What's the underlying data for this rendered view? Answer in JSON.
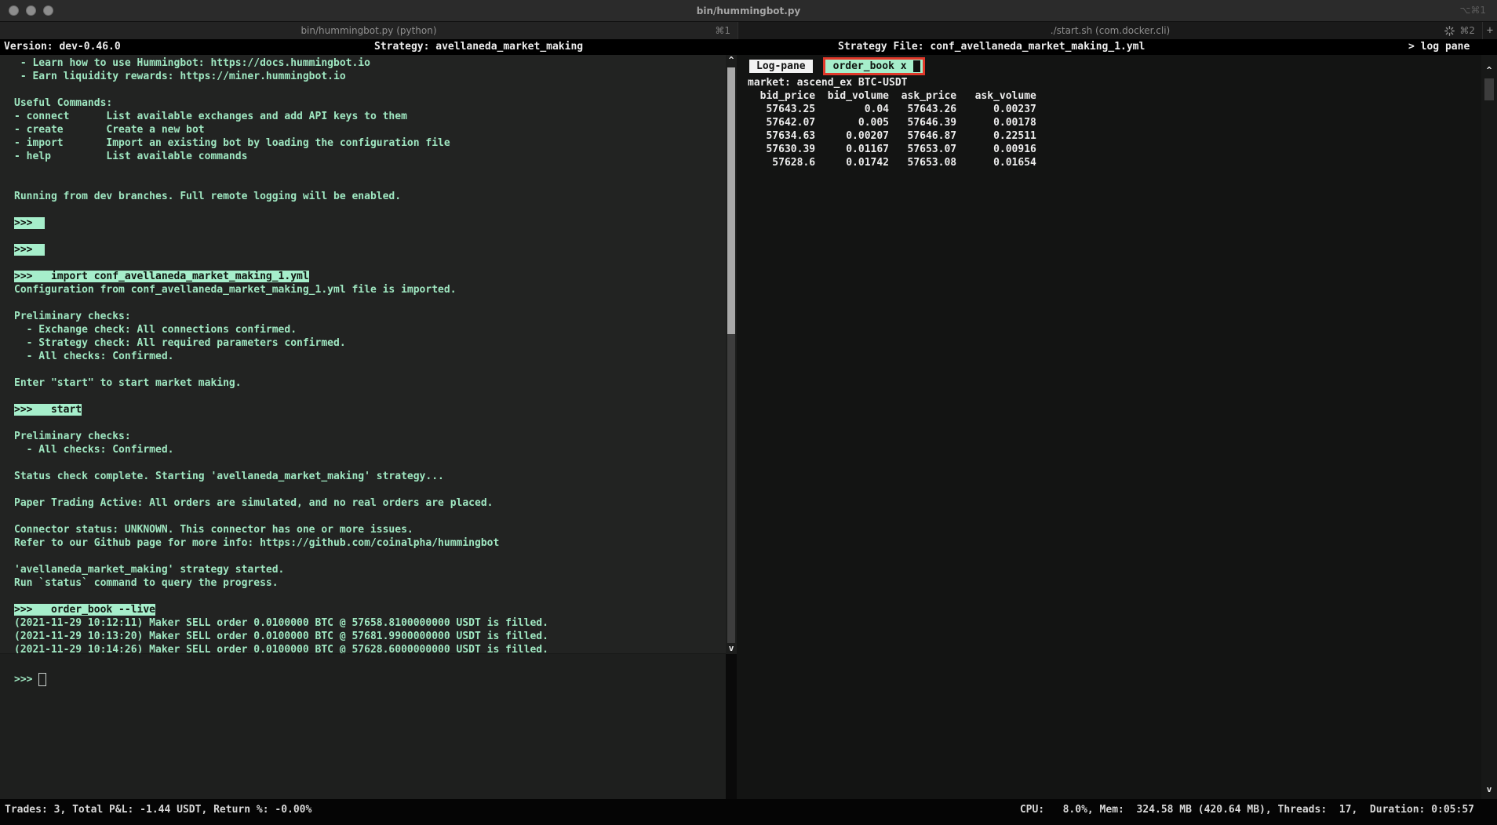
{
  "window": {
    "title": "bin/hummingbot.py",
    "titlebar_shortcut": "⌥⌘1",
    "tabs": [
      {
        "label": "bin/hummingbot.py (python)",
        "shortcut": "⌘1"
      },
      {
        "label": "./start.sh (com.docker.cli)",
        "shortcut": "⌘2"
      }
    ],
    "new_tab_button": "+"
  },
  "header": {
    "version": "Version: dev-0.46.0",
    "strategy": "Strategy: avellaneda_market_making",
    "strategy_file": "Strategy File: conf_avellaneda_market_making_1.yml",
    "log_pane_link": "> log pane"
  },
  "left_pane": {
    "lines": [
      {
        "text": " - Learn how to use Hummingbot: https://docs.hummingbot.io",
        "highlighted": false
      },
      {
        "text": " - Earn liquidity rewards: https://miner.hummingbot.io",
        "highlighted": false
      },
      {
        "text": "",
        "highlighted": false
      },
      {
        "text": "Useful Commands:",
        "highlighted": false
      },
      {
        "text": "- connect      List available exchanges and add API keys to them",
        "highlighted": false
      },
      {
        "text": "- create       Create a new bot",
        "highlighted": false
      },
      {
        "text": "- import       Import an existing bot by loading the configuration file",
        "highlighted": false
      },
      {
        "text": "- help         List available commands",
        "highlighted": false
      },
      {
        "text": "",
        "highlighted": false
      },
      {
        "text": "",
        "highlighted": false
      },
      {
        "text": "Running from dev branches. Full remote logging will be enabled.",
        "highlighted": false
      },
      {
        "text": "",
        "highlighted": false
      },
      {
        "text": ">>>  ",
        "highlighted": true
      },
      {
        "text": "",
        "highlighted": false
      },
      {
        "text": ">>>  ",
        "highlighted": true
      },
      {
        "text": "",
        "highlighted": false
      },
      {
        "text": ">>>   import conf_avellaneda_market_making_1.yml",
        "highlighted": true
      },
      {
        "text": "Configuration from conf_avellaneda_market_making_1.yml file is imported.",
        "highlighted": false
      },
      {
        "text": "",
        "highlighted": false
      },
      {
        "text": "Preliminary checks:",
        "highlighted": false
      },
      {
        "text": "  - Exchange check: All connections confirmed.",
        "highlighted": false
      },
      {
        "text": "  - Strategy check: All required parameters confirmed.",
        "highlighted": false
      },
      {
        "text": "  - All checks: Confirmed.",
        "highlighted": false
      },
      {
        "text": "",
        "highlighted": false
      },
      {
        "text": "Enter \"start\" to start market making.",
        "highlighted": false
      },
      {
        "text": "",
        "highlighted": false
      },
      {
        "text": ">>>   start",
        "highlighted": true
      },
      {
        "text": "",
        "highlighted": false
      },
      {
        "text": "Preliminary checks:",
        "highlighted": false
      },
      {
        "text": "  - All checks: Confirmed.",
        "highlighted": false
      },
      {
        "text": "",
        "highlighted": false
      },
      {
        "text": "Status check complete. Starting 'avellaneda_market_making' strategy...",
        "highlighted": false
      },
      {
        "text": "",
        "highlighted": false
      },
      {
        "text": "Paper Trading Active: All orders are simulated, and no real orders are placed.",
        "highlighted": false
      },
      {
        "text": "",
        "highlighted": false
      },
      {
        "text": "Connector status: UNKNOWN. This connector has one or more issues.",
        "highlighted": false
      },
      {
        "text": "Refer to our Github page for more info: https://github.com/coinalpha/hummingbot",
        "highlighted": false
      },
      {
        "text": "",
        "highlighted": false
      },
      {
        "text": "'avellaneda_market_making' strategy started.",
        "highlighted": false
      },
      {
        "text": "Run `status` command to query the progress.",
        "highlighted": false
      },
      {
        "text": "",
        "highlighted": false
      },
      {
        "text": ">>>   order_book --live",
        "highlighted": true
      },
      {
        "text": "(2021-11-29 10:12:11) Maker SELL order 0.0100000 BTC @ 57658.8100000000 USDT is filled.",
        "highlighted": false
      },
      {
        "text": "(2021-11-29 10:13:20) Maker SELL order 0.0100000 BTC @ 57681.9900000000 USDT is filled.",
        "highlighted": false
      },
      {
        "text": "(2021-11-29 10:14:26) Maker SELL order 0.0100000 BTC @ 57628.6000000000 USDT is filled.",
        "highlighted": false
      }
    ],
    "input_prompt": ">>>",
    "scroll_up": "^",
    "scroll_down": "v"
  },
  "right_pane": {
    "tabs": [
      {
        "label": "Log-pane",
        "active": false
      },
      {
        "label": "order_book x",
        "active": true
      }
    ],
    "market": "market: ascend_ex BTC-USDT",
    "order_book": {
      "columns": [
        "bid_price",
        "bid_volume",
        "ask_price",
        "ask_volume"
      ],
      "rows": [
        [
          "57643.25",
          "0.04",
          "57643.26",
          "0.00237"
        ],
        [
          "57642.07",
          "0.005",
          "57646.39",
          "0.00178"
        ],
        [
          "57634.63",
          "0.00207",
          "57646.87",
          "0.22511"
        ],
        [
          "57630.39",
          "0.01167",
          "57653.07",
          "0.00916"
        ],
        [
          "57628.6",
          "0.01742",
          "57653.08",
          "0.01654"
        ]
      ]
    },
    "scroll_up": "^",
    "scroll_down": "v"
  },
  "status_bar": {
    "left": "Trades: 3, Total P&L: -1.44 USDT, Return %: -0.00%",
    "right": "CPU:   8.0%, Mem:  324.58 MB (420.64 MB), Threads:  17,  Duration: 0:05:57"
  },
  "colors": {
    "terminal_green": "#9fe7c1",
    "highlight_bg": "#a6eecb",
    "order_book_tab_border": "#e0382a",
    "left_pane_bg": "#222322",
    "right_pane_bg": "#131413",
    "header_bg": "#000000"
  }
}
